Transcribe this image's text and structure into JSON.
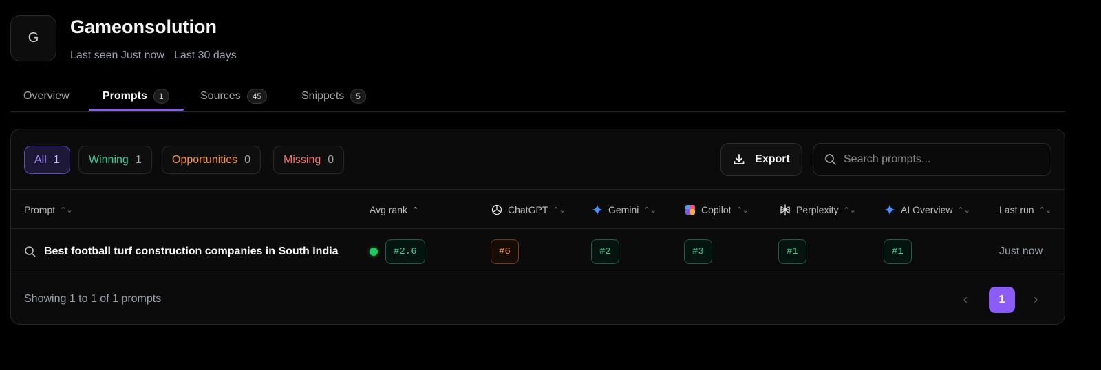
{
  "project": {
    "avatar_letter": "G",
    "name": "Gameonsolution",
    "last_seen": "Last seen Just now",
    "range": "Last 30 days"
  },
  "tabs": [
    {
      "label": "Overview",
      "count": ""
    },
    {
      "label": "Prompts",
      "count": "1"
    },
    {
      "label": "Sources",
      "count": "45"
    },
    {
      "label": "Snippets",
      "count": "5"
    }
  ],
  "active_tab": "Prompts",
  "filters": [
    {
      "label": "All",
      "count": "1"
    },
    {
      "label": "Winning",
      "count": "1"
    },
    {
      "label": "Opportunities",
      "count": "0"
    },
    {
      "label": "Missing",
      "count": "0"
    }
  ],
  "toolbar": {
    "export_label": "Export",
    "search_placeholder": "Search prompts..."
  },
  "table": {
    "columns": [
      "Prompt",
      "Avg rank",
      "ChatGPT",
      "Gemini",
      "Copilot",
      "Perplexity",
      "AI Overview",
      "Last run"
    ],
    "rows": [
      {
        "prompt": "Best football turf construction companies in South India",
        "avg_rank": "#2.6",
        "chatgpt": "#6",
        "gemini": "#2",
        "copilot": "#3",
        "perplexity": "#1",
        "ai_overview": "#1",
        "last_run": "Just now"
      }
    ]
  },
  "footer": {
    "showing": "Showing 1 to 1 of 1 prompts",
    "current_page": "1"
  },
  "colors": {
    "accent": "#8b5cf6",
    "winning": "#34d399",
    "opportunities": "#fb923c",
    "missing": "#f87171"
  }
}
